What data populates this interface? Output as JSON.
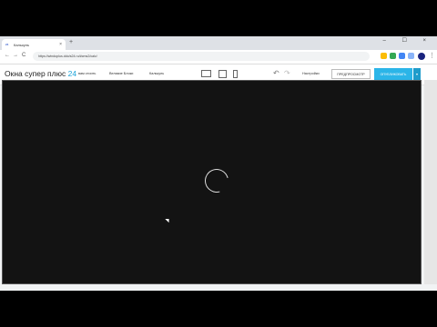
{
  "browser": {
    "tab_title": "Калькуль",
    "tab_close": "×",
    "new_tab": "+",
    "window_controls": "– ☐ ×",
    "url": "https://windoplus.ddo/s24.ru/#cms2/calc/",
    "nav_back": "←",
    "nav_forward": "→",
    "nav_reload": "C",
    "menu": "⋮"
  },
  "app": {
    "title_main": "Окна супер плюс ",
    "title_accent": "24",
    "menu": {
      "item1": "вам стоить",
      "item2": "Великие Блоки ",
      "item3": "Калькуль "
    },
    "undo": "↶",
    "redo": "↷",
    "settings_label": "Настройки ",
    "preview_label": "ПРЕДПРОСМОТР",
    "publish_label": "ОПУБЛИКОВАТЬ",
    "publish_arrow": "▾"
  },
  "colors": {
    "accent": "#1aa3d9",
    "publish": "#2bb5e8",
    "canvas": "#131313"
  }
}
